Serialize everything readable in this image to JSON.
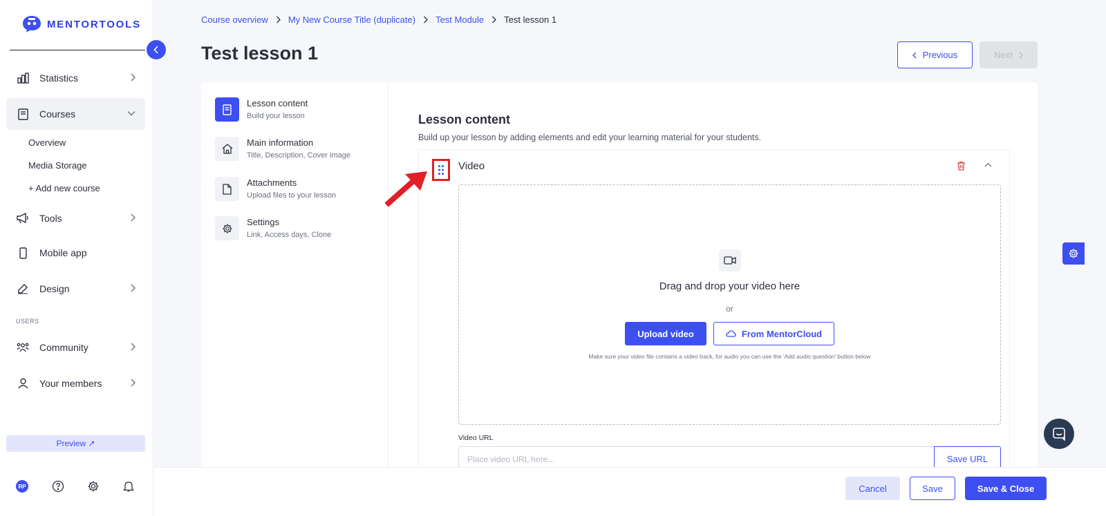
{
  "app": {
    "logo_text": "MENTORTOOLS"
  },
  "sidebar": {
    "items": [
      {
        "label": "Statistics"
      },
      {
        "label": "Courses"
      },
      {
        "label": "Tools"
      },
      {
        "label": "Mobile app"
      },
      {
        "label": "Design"
      },
      {
        "label": "Community"
      },
      {
        "label": "Your members"
      }
    ],
    "courses_sub": [
      "Overview",
      "Media Storage",
      "+ Add new course"
    ],
    "section_users": "USERS",
    "preview_label": "Preview ↗",
    "avatar_initials": "RP"
  },
  "breadcrumb": [
    "Course overview",
    "My New Course Title (duplicate)",
    "Test Module",
    "Test lesson 1"
  ],
  "page": {
    "title": "Test lesson 1",
    "previous_label": "Previous",
    "next_label": "Next"
  },
  "steps": [
    {
      "title": "Lesson content",
      "subtitle": "Build your lesson"
    },
    {
      "title": "Main information",
      "subtitle": "Title, Description, Cover image"
    },
    {
      "title": "Attachments",
      "subtitle": "Upload files to your lesson"
    },
    {
      "title": "Settings",
      "subtitle": "Link, Access days, Clone"
    }
  ],
  "lesson_content": {
    "title": "Lesson content",
    "description": "Build up your lesson by adding elements and edit your learning material for your students.",
    "block_title": "Video",
    "dropzone_main": "Drag and drop your video here",
    "dropzone_or": "or",
    "upload_label": "Upload video",
    "cloud_label": "From MentorCloud",
    "hint": "Make sure your video file contains a video track, for audio you can use the 'Add audio question' button below",
    "url_label": "Video URL",
    "url_placeholder": "Place video URL here...",
    "url_value": "",
    "save_url_label": "Save URL"
  },
  "footer": {
    "cancel_label": "Cancel",
    "save_label": "Save",
    "save_close_label": "Save & Close"
  },
  "colors": {
    "accent": "#3d4ff0",
    "annotation_red": "#e11f26",
    "delete_red": "#e5484d",
    "text": "#2c2f3a",
    "background": "#f6f7fb"
  }
}
